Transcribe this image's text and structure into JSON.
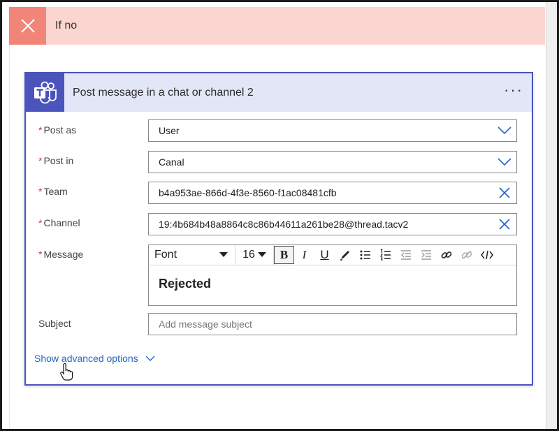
{
  "condition": {
    "label": "If no"
  },
  "card": {
    "title": "Post message in a chat or channel 2",
    "more": "···",
    "fields": {
      "post_as": {
        "label": "Post as",
        "value": "User"
      },
      "post_in": {
        "label": "Post in",
        "value": "Canal"
      },
      "team": {
        "label": "Team",
        "value": "b4a953ae-866d-4f3e-8560-f1ac08481cfb"
      },
      "channel": {
        "label": "Channel",
        "value": "19:4b684b48a8864c8c86b44611a261be28@thread.tacv2"
      },
      "message": {
        "label": "Message",
        "value": "Rejected"
      },
      "subject": {
        "label": "Subject",
        "placeholder": "Add message subject"
      }
    },
    "toolbar": {
      "font": "Font",
      "size": "16",
      "bold": "B",
      "italic": "I",
      "underline": "U"
    },
    "advanced": "Show advanced options"
  },
  "colors": {
    "accent": "#4b53bc",
    "condition_bg": "#fbd6d1",
    "condition_icon_bg": "#f2857a",
    "link": "#2266c4"
  }
}
